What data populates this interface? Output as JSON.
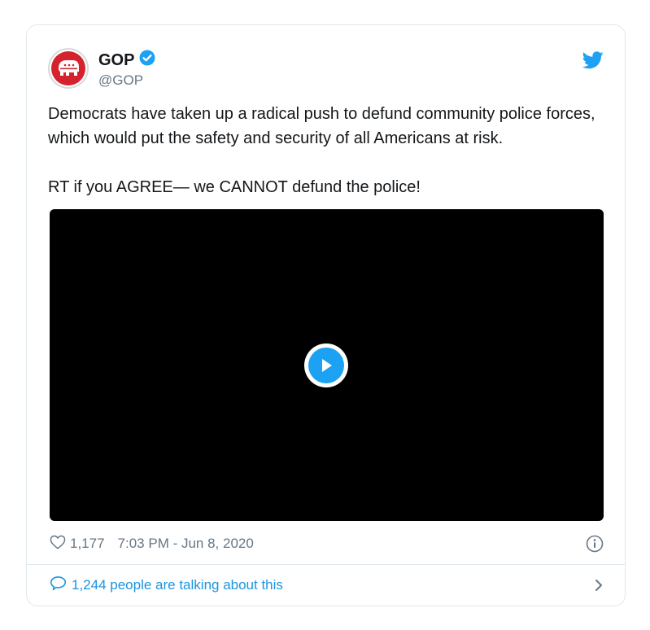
{
  "tweet": {
    "author_name": "GOP",
    "author_handle": "@GOP",
    "verified": true,
    "paragraphs": [
      "Democrats have taken up a radical push to defund community police forces, which would put the safety and security of all Americans at risk.",
      "RT if you AGREE— we CANNOT defund the police!"
    ],
    "likes": "1,177",
    "timestamp": "7:03 PM - Jun 8, 2020",
    "talking": "1,244 people are talking about this"
  },
  "icons": {
    "avatar": "republican-elephant-logo",
    "verified": "verified-badge-icon",
    "brand": "twitter-bird-icon",
    "play": "play-icon",
    "like": "heart-icon",
    "info": "info-icon",
    "reply": "speech-bubble-icon",
    "chevron": "chevron-right-icon"
  },
  "colors": {
    "accent": "#1da1f2",
    "link": "#1b95e0",
    "muted": "#657786",
    "text": "#14171a",
    "brand_red": "#d4232f",
    "video_bg": "#000000"
  }
}
